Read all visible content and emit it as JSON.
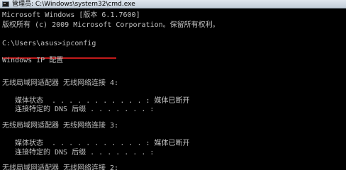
{
  "window": {
    "title": "管理员: C:\\Windows\\system32\\cmd.exe",
    "icon": "cmd-icon"
  },
  "console": {
    "lines": [
      "Microsoft Windows [版本 6.1.7600]",
      "版权所有 (c) 2009 Microsoft Corporation。保留所有权利。",
      "",
      "C:\\Users\\asus>ipconfig",
      "",
      "Windows IP 配置",
      "",
      "",
      "无线局域网适配器 无线网络连接 4:",
      "",
      "媒体状态  . . . . . . . . . . . : 媒体已断开",
      "连接特定的 DNS 后缀 . . . . . . . :",
      "",
      "无线局域网适配器 无线网络连接 3:",
      "",
      "媒体状态  . . . . . . . . . . . : 媒体已断开",
      "连接特定的 DNS 后缀 . . . . . . . :",
      "",
      "无线局域网适配器 无线网络连接 2:"
    ]
  },
  "colors": {
    "console_bg": "#000000",
    "console_text": "#c0c0c0",
    "annotation_underline": "#c31a1a"
  }
}
